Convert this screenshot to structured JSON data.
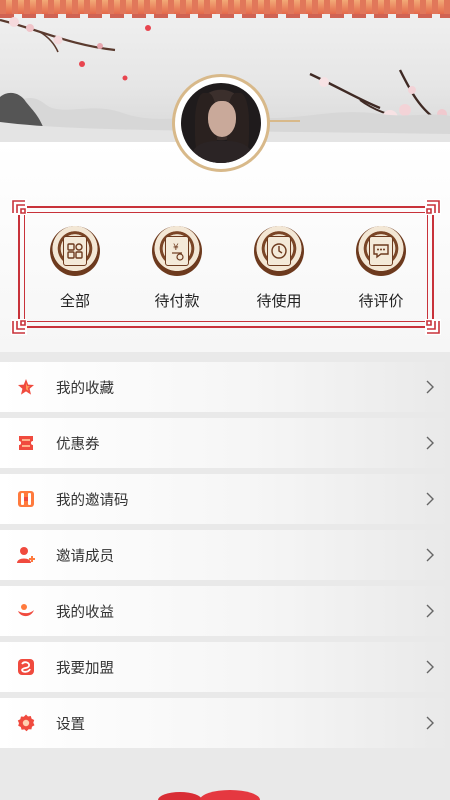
{
  "orders": {
    "items": [
      {
        "label": "全部",
        "icon": "grid-icon"
      },
      {
        "label": "待付款",
        "icon": "payment-icon"
      },
      {
        "label": "待使用",
        "icon": "clock-icon"
      },
      {
        "label": "待评价",
        "icon": "comment-icon"
      }
    ]
  },
  "menu": {
    "items": [
      {
        "label": "我的收藏",
        "icon": "star-icon"
      },
      {
        "label": "优惠券",
        "icon": "coupon-icon"
      },
      {
        "label": "我的邀请码",
        "icon": "invite-code-icon"
      },
      {
        "label": "邀请成员",
        "icon": "add-user-icon"
      },
      {
        "label": "我的收益",
        "icon": "earnings-icon"
      },
      {
        "label": "我要加盟",
        "icon": "join-icon"
      },
      {
        "label": "设置",
        "icon": "settings-icon"
      }
    ]
  },
  "colors": {
    "accent": "#c8323a",
    "icon_red": "#f04a3e",
    "icon_orange": "#ff7a3d",
    "order_brown": "#6d3a1e"
  }
}
